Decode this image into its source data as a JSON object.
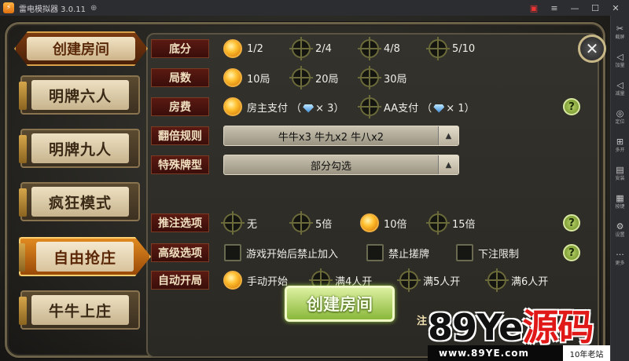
{
  "emulator": {
    "title": "雷电模拟器 3.0.11",
    "controls": {
      "gift": "▣",
      "menu": "≡",
      "minimize": "—",
      "maximize": "☐",
      "close": "✕"
    },
    "sidebar": [
      {
        "icon": "scissors-icon",
        "glyph": "✂",
        "label": "截屏"
      },
      {
        "icon": "volume-up-icon",
        "glyph": "◁",
        "label": "加量"
      },
      {
        "icon": "volume-down-icon",
        "glyph": "◁",
        "label": "减量"
      },
      {
        "icon": "location-icon",
        "glyph": "◎",
        "label": "定位"
      },
      {
        "icon": "multi-open-icon",
        "glyph": "⊞",
        "label": "多开"
      },
      {
        "icon": "apk-install-icon",
        "glyph": "▤",
        "label": "安装"
      },
      {
        "icon": "keyboard-icon",
        "glyph": "▦",
        "label": "按键"
      },
      {
        "icon": "settings-icon",
        "glyph": "⚙",
        "label": "设置"
      },
      {
        "icon": "more-icon",
        "glyph": "···",
        "label": "更多"
      }
    ]
  },
  "header": {
    "title": "创建房间"
  },
  "tabs": [
    {
      "label": "明牌六人",
      "active": false
    },
    {
      "label": "明牌九人",
      "active": false
    },
    {
      "label": "疯狂模式",
      "active": false
    },
    {
      "label": "自由抢庄",
      "active": true
    },
    {
      "label": "牛牛上庄",
      "active": false
    }
  ],
  "rows": {
    "base": {
      "label": "底分",
      "options": [
        {
          "text": "1/2",
          "on": true
        },
        {
          "text": "2/4",
          "on": false
        },
        {
          "text": "4/8",
          "on": false
        },
        {
          "text": "5/10",
          "on": false
        }
      ]
    },
    "rounds": {
      "label": "局数",
      "options": [
        {
          "text": "10局",
          "on": true
        },
        {
          "text": "20局",
          "on": false
        },
        {
          "text": "30局",
          "on": false
        }
      ]
    },
    "fee": {
      "label": "房费",
      "owner": "房主支付",
      "owner_cost": "× 3",
      "aa": "AA支付",
      "aa_cost": "× 1"
    },
    "multiplier": {
      "label": "翻倍规则",
      "value": "牛牛x3  牛九x2  牛八x2"
    },
    "special": {
      "label": "特殊牌型",
      "value": "部分勾选"
    },
    "bet": {
      "label": "推注选项",
      "options": [
        {
          "text": "无",
          "on": false
        },
        {
          "text": "5倍",
          "on": false
        },
        {
          "text": "10倍",
          "on": true
        },
        {
          "text": "15倍",
          "on": false
        }
      ]
    },
    "advanced": {
      "label": "高级选项",
      "options": [
        "游戏开始后禁止加入",
        "禁止搓牌",
        "下注限制"
      ]
    },
    "autostart": {
      "label": "自动开局",
      "options": [
        {
          "text": "手动开始",
          "on": true
        },
        {
          "text": "满4人开",
          "on": false
        },
        {
          "text": "满5人开",
          "on": false
        },
        {
          "text": "满6人开",
          "on": false
        }
      ]
    }
  },
  "help_glyph": "?",
  "close_glyph": "✕",
  "create_button": "创建房间",
  "note_text": "注",
  "watermark": {
    "part1": "89Ye",
    "part2": "源码",
    "url": "www.89YE.com",
    "tag": "10年老站"
  }
}
